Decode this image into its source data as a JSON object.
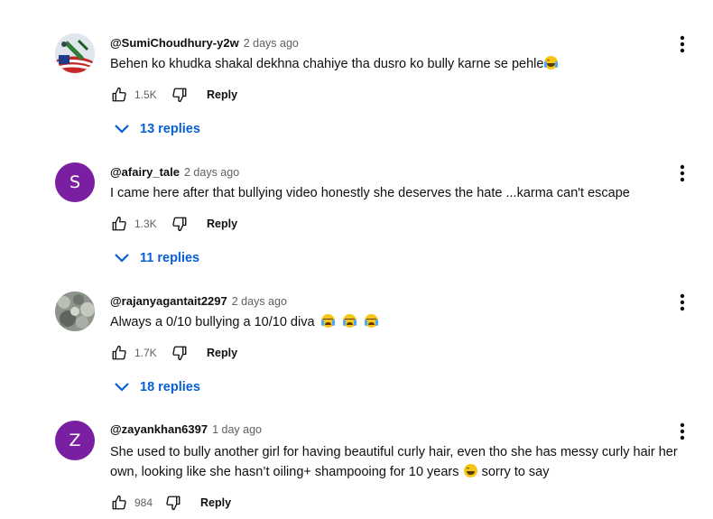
{
  "comments": [
    {
      "author": "@SumiChoudhury-y2w",
      "time": "2 days ago",
      "text": "Behen ko khudka shakal dekhna chahiye tha dusro ko bully karne se pehle",
      "emoji": "joy",
      "likes": "1.5K",
      "reply_label": "Reply",
      "replies": "13 replies",
      "avatar": "image"
    },
    {
      "author": "@afairy_tale",
      "time": "2 days ago",
      "text": "I came here after that bullying video honestly she deserves the hate ...karma can't escape",
      "likes": "1.3K",
      "reply_label": "Reply",
      "replies": "11 replies",
      "avatar_letter": "S",
      "avatar_color": "#7b1fa2"
    },
    {
      "author": "@rajanyagantait2297",
      "time": "2 days ago",
      "text": "Always a 0/10 bullying a 10/10 diva",
      "emoji": "sob x3",
      "likes": "1.7K",
      "reply_label": "Reply",
      "replies": "18 replies",
      "avatar": "image"
    },
    {
      "author": "@zayankhan6397",
      "time": "1 day ago",
      "text_part1": "She used to bully another girl for having beautiful curly hair, even tho she has messy curly hair her own, looking like she hasn’t  oiling+ shampooing  for 10 years",
      "text_part2": "sorry to say",
      "emoji": "grin-sweat",
      "likes": "984",
      "reply_label": "Reply",
      "avatar_letter": "Z",
      "avatar_color": "#7b1fa2"
    }
  ],
  "icons": {
    "like": "thumbs-up-icon",
    "dislike": "thumbs-down-icon",
    "menu": "more-vertical-icon",
    "expand": "chevron-down-icon"
  },
  "colors": {
    "link": "#065fd4",
    "avatar_purple": "#7b1fa2"
  }
}
